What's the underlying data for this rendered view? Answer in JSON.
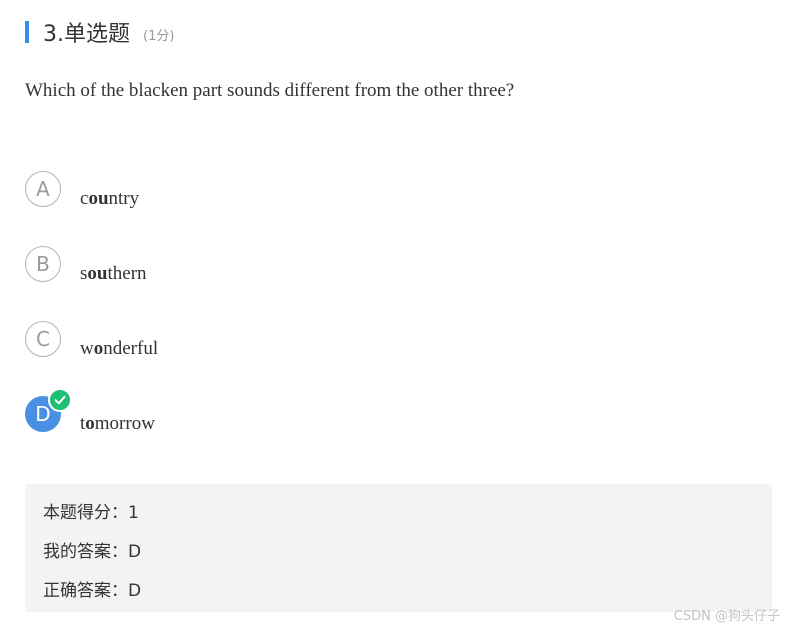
{
  "question": {
    "title": "3.单选题",
    "score": "(1分)",
    "text": "Which of the blacken part sounds different from the other three?"
  },
  "options": [
    {
      "letter": "A",
      "pre": "c",
      "bold": "ou",
      "post": "ntry",
      "selected": false
    },
    {
      "letter": "B",
      "pre": "s",
      "bold": "ou",
      "post": "thern",
      "selected": false
    },
    {
      "letter": "C",
      "pre": "w",
      "bold": "o",
      "post": "nderful",
      "selected": false
    },
    {
      "letter": "D",
      "pre": "t",
      "bold": "o",
      "post": "morrow",
      "selected": true
    }
  ],
  "result": {
    "score_line": "本题得分：1",
    "my_answer": "我的答案：D",
    "correct_answer": "正确答案：D"
  },
  "watermark": "CSDN @狗头仔子",
  "colors": {
    "accent_bar": "#3a8ee6",
    "selected_circle": "#4a90e2",
    "check_badge": "#1fbf73"
  }
}
